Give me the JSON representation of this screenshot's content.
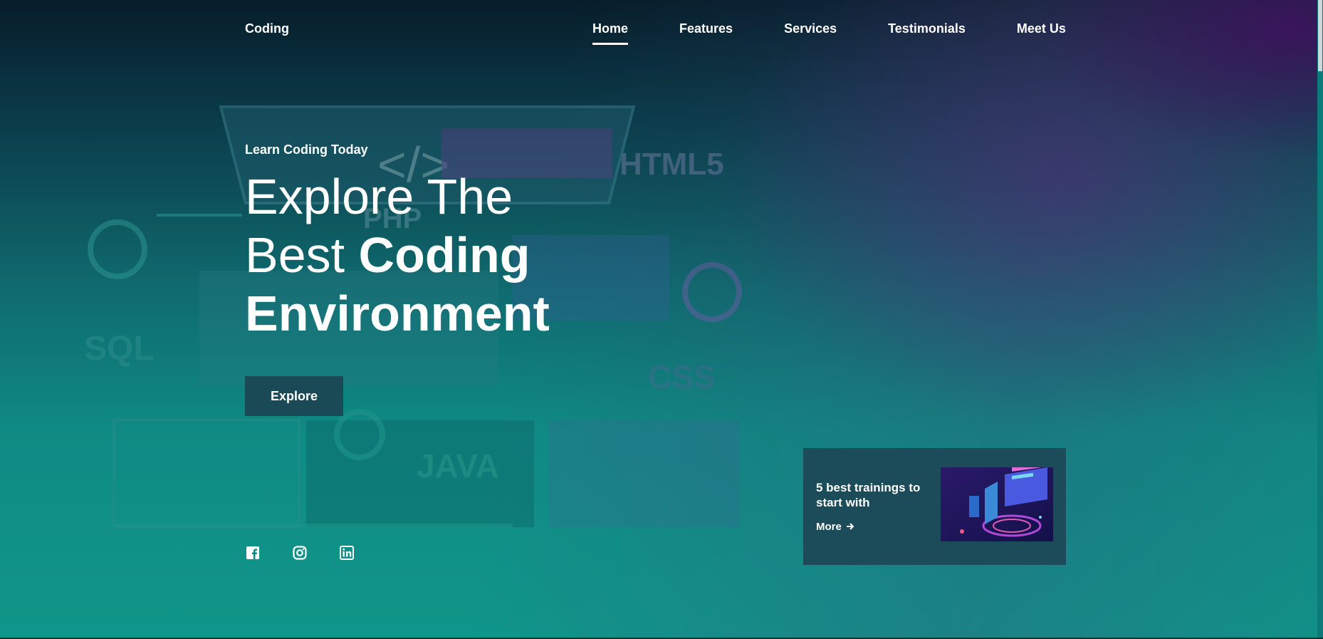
{
  "brand": "Coding",
  "nav": {
    "items": [
      "Home",
      "Features",
      "Services",
      "Testimonials",
      "Meet Us"
    ],
    "active": "Home"
  },
  "hero": {
    "eyebrow": "Learn Coding Today",
    "headline_line1": "Explore The",
    "headline_line2_regular": "Best ",
    "headline_line2_bold": "Coding",
    "headline_line3_bold": "Environment",
    "cta_label": "Explore",
    "background_labels": [
      "HTML5",
      "PHP",
      "SQL",
      "CSS",
      "JAVA"
    ]
  },
  "socials": [
    "facebook-icon",
    "instagram-icon",
    "linkedin-icon"
  ],
  "card": {
    "title": "5 best trainings to start with",
    "link_label": "More",
    "link_icon": "arrow-right-icon"
  },
  "colors": {
    "button_bg": "#1b4a57",
    "card_bg": "#1c4c5a",
    "accent_purple": "#4a0f5c",
    "teal": "#10968a"
  }
}
